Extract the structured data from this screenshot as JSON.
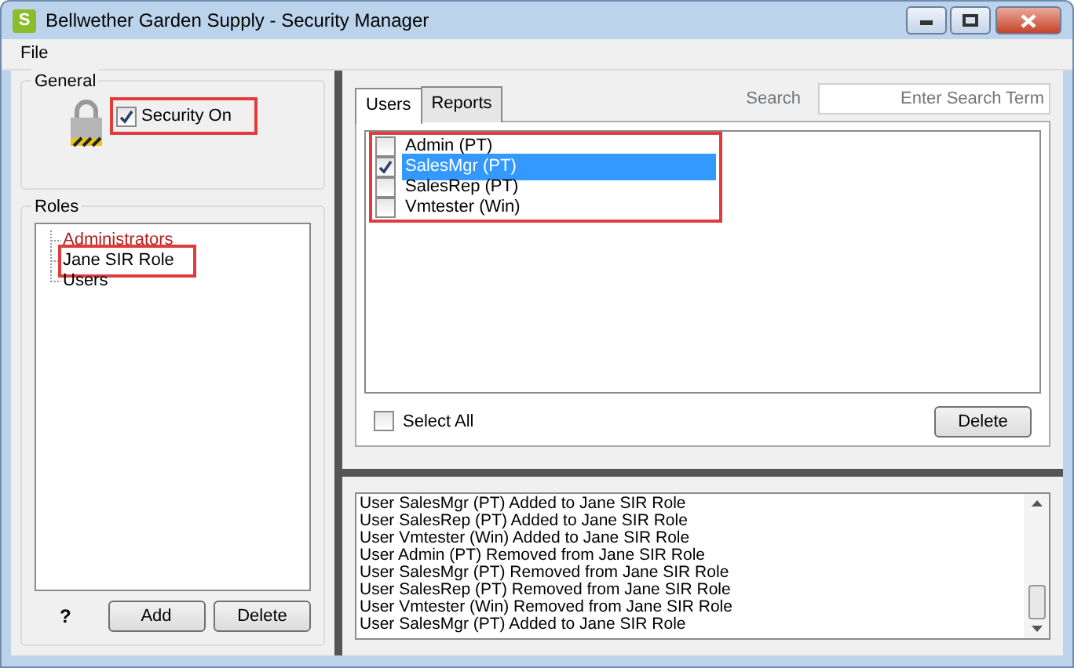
{
  "window": {
    "title": "Bellwether Garden Supply - Security Manager",
    "app_letter": "S"
  },
  "menu": [
    "File"
  ],
  "general": {
    "title": "General",
    "security": {
      "label": "Security On",
      "checked": true,
      "highlighted": true
    }
  },
  "roles": {
    "title": "Roles",
    "items": [
      {
        "label": "Administrators",
        "color": "#b22222",
        "highlighted": false
      },
      {
        "label": "Jane SIR Role",
        "color": "#000000",
        "highlighted": true
      },
      {
        "label": "Users",
        "color": "#000000",
        "highlighted": false
      }
    ],
    "help": "?",
    "buttons": [
      "Add",
      "Delete"
    ]
  },
  "tabs": [
    {
      "label": "Users",
      "selected": true
    },
    {
      "label": "Reports",
      "selected": false
    }
  ],
  "search": {
    "label": "Search",
    "placeholder": "Enter Search Term"
  },
  "users": {
    "highlighted": true,
    "items": [
      {
        "label": "Admin (PT)",
        "checked": false,
        "selected": false
      },
      {
        "label": "SalesMgr (PT)",
        "checked": true,
        "selected": true
      },
      {
        "label": "SalesRep (PT)",
        "checked": false,
        "selected": false
      },
      {
        "label": "Vmtester (Win)",
        "checked": false,
        "selected": false
      }
    ]
  },
  "select_all": {
    "label": "Select All",
    "checked": false
  },
  "delete_button": "Delete",
  "log": [
    "User SalesMgr (PT) Added to Jane SIR Role",
    "User SalesRep (PT) Added to Jane SIR Role",
    "User Vmtester (Win) Added to Jane SIR Role",
    "User Admin (PT) Removed from Jane SIR Role",
    "User SalesMgr (PT) Removed from Jane SIR Role",
    "User SalesRep (PT) Removed from Jane SIR Role",
    "User Vmtester (Win) Removed from Jane SIR Role",
    "User SalesMgr (PT) Added to Jane SIR Role"
  ]
}
